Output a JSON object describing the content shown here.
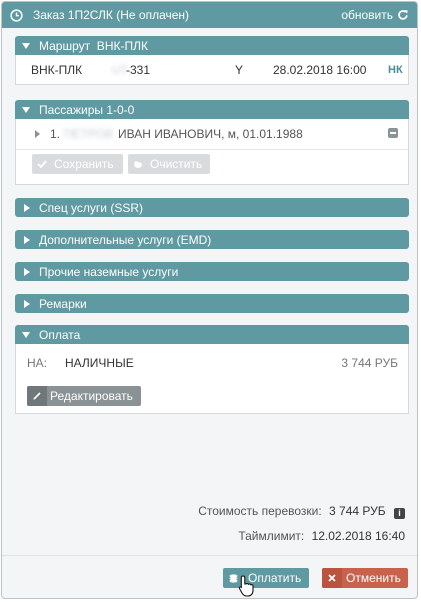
{
  "window": {
    "title": "Заказ 1П2СЛК (Не оплачен)",
    "refresh_label": "обновить"
  },
  "route": {
    "header": "Маршрут  ВНК-ПЛК",
    "segment": {
      "route": "ВНК-ПЛК",
      "flight": "-331",
      "class": "Y",
      "datetime": "28.02.2018 16:00",
      "status": "НК"
    }
  },
  "passengers": {
    "header": "Пассажиры 1-0-0",
    "items": [
      {
        "index": "1.",
        "surname_hidden": "ПЕТРОВ",
        "rest": "ИВАН ИВАНОВИЧ, м, 01.01.1988"
      }
    ],
    "save_label": "Сохранить",
    "clear_label": "Очистить"
  },
  "sections": {
    "ssr": "Спец услуги (SSR)",
    "emd": "Дополнительные услуги (EMD)",
    "ground": "Прочие наземные услуги",
    "remarks": "Ремарки"
  },
  "payment": {
    "header": "Оплата",
    "method_code": "НА:",
    "method_name": "НАЛИЧНЫЕ",
    "amount": "3 744 РУБ",
    "edit_label": "Редактировать"
  },
  "summary": {
    "cost_label": "Стоимость перевозки:",
    "cost_value": "3 744 РУБ",
    "timelimit_label": "Таймлимит:",
    "timelimit_value": "12.02.2018 16:40"
  },
  "actions": {
    "pay_label": "Оплатить",
    "cancel_label": "Отменить"
  },
  "colors": {
    "header": "#5f9aa2",
    "pay": "#5f9aa2",
    "cancel": "#c9624c",
    "disabled": "#d8dcde"
  }
}
